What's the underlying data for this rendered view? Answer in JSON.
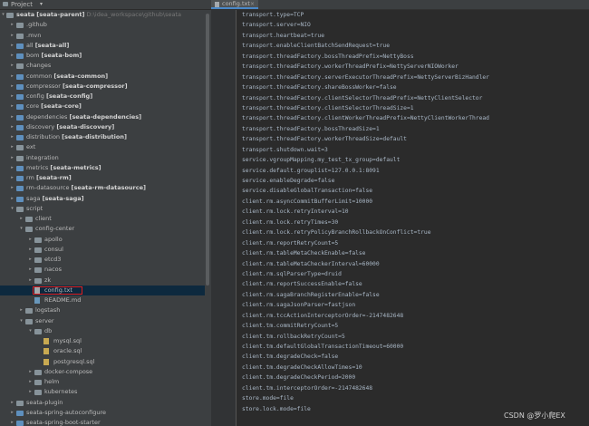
{
  "panel": {
    "title": "Project",
    "arrow": "▾",
    "root": {
      "name": "seata",
      "module": "[seata-parent]",
      "path": "D:\\idea_workspace\\github\\seata"
    }
  },
  "tree": [
    {
      "level": 1,
      "arrow": "▸",
      "icon": "folder",
      "name": ".github"
    },
    {
      "level": 1,
      "arrow": "▸",
      "icon": "folder",
      "name": ".mvn"
    },
    {
      "level": 1,
      "arrow": "▸",
      "icon": "module",
      "name": "all",
      "module": "[seata-all]"
    },
    {
      "level": 1,
      "arrow": "▸",
      "icon": "module",
      "name": "bom",
      "module": "[seata-bom]"
    },
    {
      "level": 1,
      "arrow": "▸",
      "icon": "folder",
      "name": "changes"
    },
    {
      "level": 1,
      "arrow": "▸",
      "icon": "module",
      "name": "common",
      "module": "[seata-common]"
    },
    {
      "level": 1,
      "arrow": "▸",
      "icon": "module",
      "name": "compressor",
      "module": "[seata-compressor]"
    },
    {
      "level": 1,
      "arrow": "▸",
      "icon": "module",
      "name": "config",
      "module": "[seata-config]"
    },
    {
      "level": 1,
      "arrow": "▸",
      "icon": "module",
      "name": "core",
      "module": "[seata-core]"
    },
    {
      "level": 1,
      "arrow": "▸",
      "icon": "module",
      "name": "dependencies",
      "module": "[seata-dependencies]"
    },
    {
      "level": 1,
      "arrow": "▸",
      "icon": "module",
      "name": "discovery",
      "module": "[seata-discovery]"
    },
    {
      "level": 1,
      "arrow": "▸",
      "icon": "module",
      "name": "distribution",
      "module": "[seata-distribution]"
    },
    {
      "level": 1,
      "arrow": "▸",
      "icon": "folder",
      "name": "ext"
    },
    {
      "level": 1,
      "arrow": "▸",
      "icon": "folder",
      "name": "integration"
    },
    {
      "level": 1,
      "arrow": "▸",
      "icon": "module",
      "name": "metrics",
      "module": "[seata-metrics]"
    },
    {
      "level": 1,
      "arrow": "▸",
      "icon": "module",
      "name": "rm",
      "module": "[seata-rm]"
    },
    {
      "level": 1,
      "arrow": "▸",
      "icon": "module",
      "name": "rm-datasource",
      "module": "[seata-rm-datasource]"
    },
    {
      "level": 1,
      "arrow": "▸",
      "icon": "module",
      "name": "saga",
      "module": "[seata-saga]"
    },
    {
      "level": 1,
      "arrow": "▾",
      "icon": "folder",
      "name": "script"
    },
    {
      "level": 2,
      "arrow": "▸",
      "icon": "folder",
      "name": "client"
    },
    {
      "level": 2,
      "arrow": "▾",
      "icon": "folder",
      "name": "config-center"
    },
    {
      "level": 3,
      "arrow": "▸",
      "icon": "folder",
      "name": "apollo"
    },
    {
      "level": 3,
      "arrow": "▸",
      "icon": "folder",
      "name": "consul"
    },
    {
      "level": 3,
      "arrow": "▸",
      "icon": "folder",
      "name": "etcd3"
    },
    {
      "level": 3,
      "arrow": "▸",
      "icon": "folder",
      "name": "nacos"
    },
    {
      "level": 3,
      "arrow": "▸",
      "icon": "folder",
      "name": "zk"
    },
    {
      "level": 3,
      "arrow": "",
      "icon": "file",
      "name": "config.txt",
      "selected": true
    },
    {
      "level": 3,
      "arrow": "",
      "icon": "md",
      "name": "README.md"
    },
    {
      "level": 2,
      "arrow": "▸",
      "icon": "folder",
      "name": "logstash"
    },
    {
      "level": 2,
      "arrow": "▾",
      "icon": "folder",
      "name": "server"
    },
    {
      "level": 3,
      "arrow": "▾",
      "icon": "folder",
      "name": "db"
    },
    {
      "level": 4,
      "arrow": "",
      "icon": "sql",
      "name": "mysql.sql"
    },
    {
      "level": 4,
      "arrow": "",
      "icon": "sql",
      "name": "oracle.sql"
    },
    {
      "level": 4,
      "arrow": "",
      "icon": "sql",
      "name": "postgresql.sql"
    },
    {
      "level": 3,
      "arrow": "▸",
      "icon": "folder",
      "name": "docker-compose"
    },
    {
      "level": 3,
      "arrow": "▸",
      "icon": "folder",
      "name": "helm"
    },
    {
      "level": 3,
      "arrow": "▸",
      "icon": "folder",
      "name": "kubernetes"
    },
    {
      "level": 1,
      "arrow": "▸",
      "icon": "folder",
      "name": "seata-plugin"
    },
    {
      "level": 1,
      "arrow": "▸",
      "icon": "module",
      "name": "seata-spring-autoconfigure"
    },
    {
      "level": 1,
      "arrow": "▸",
      "icon": "module",
      "name": "seata-spring-boot-starter"
    }
  ],
  "editor": {
    "tab": {
      "label": "config.txt",
      "close": "×"
    },
    "lines": [
      "transport.type=TCP",
      "transport.server=NIO",
      "transport.heartbeat=true",
      "transport.enableClientBatchSendRequest=true",
      "transport.threadFactory.bossThreadPrefix=NettyBoss",
      "transport.threadFactory.workerThreadPrefix=NettyServerNIOWorker",
      "transport.threadFactory.serverExecutorThreadPrefix=NettyServerBizHandler",
      "transport.threadFactory.shareBossWorker=false",
      "transport.threadFactory.clientSelectorThreadPrefix=NettyClientSelector",
      "transport.threadFactory.clientSelectorThreadSize=1",
      "transport.threadFactory.clientWorkerThreadPrefix=NettyClientWorkerThread",
      "transport.threadFactory.bossThreadSize=1",
      "transport.threadFactory.workerThreadSize=default",
      "transport.shutdown.wait=3",
      "service.vgroupMapping.my_test_tx_group=default",
      "service.default.grouplist=127.0.0.1:8091",
      "service.enableDegrade=false",
      "service.disableGlobalTransaction=false",
      "client.rm.asyncCommitBufferLimit=10000",
      "client.rm.lock.retryInterval=10",
      "client.rm.lock.retryTimes=30",
      "client.rm.lock.retryPolicyBranchRollbackOnConflict=true",
      "client.rm.reportRetryCount=5",
      "client.rm.tableMetaCheckEnable=false",
      "client.rm.tableMetaCheckerInterval=60000",
      "client.rm.sqlParserType=druid",
      "client.rm.reportSuccessEnable=false",
      "client.rm.sagaBranchRegisterEnable=false",
      "client.rm.sagaJsonParser=fastjson",
      "client.rm.tccActionInterceptorOrder=-2147482648",
      "client.tm.commitRetryCount=5",
      "client.tm.rollbackRetryCount=5",
      "client.tm.defaultGlobalTransactionTimeout=60000",
      "client.tm.degradeCheck=false",
      "client.tm.degradeCheckAllowTimes=10",
      "client.tm.degradeCheckPeriod=2000",
      "client.tm.interceptorOrder=-2147482648",
      "store.mode=file",
      "store.lock.mode=file"
    ]
  },
  "watermark": "CSDN @罗小爬EX"
}
